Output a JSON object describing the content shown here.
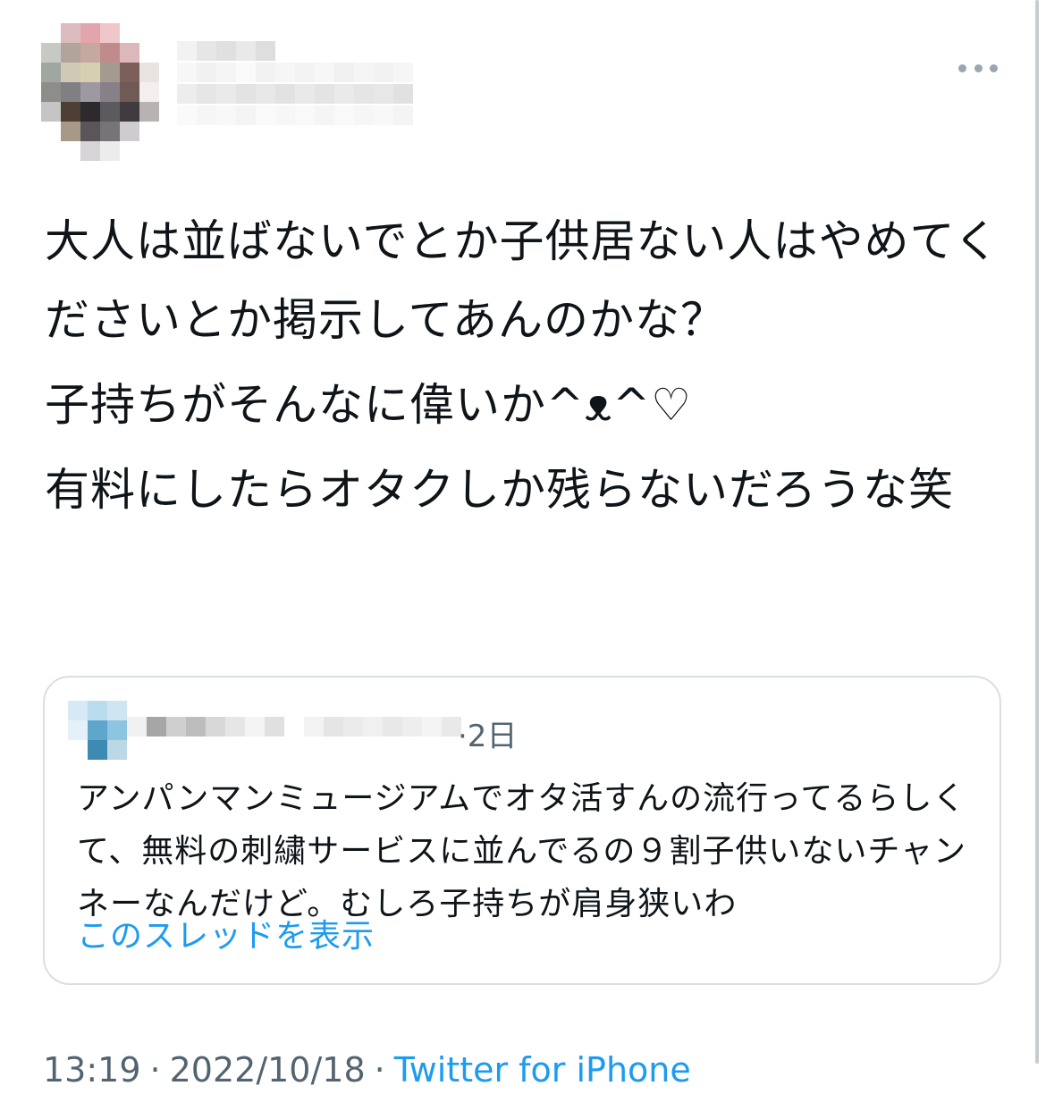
{
  "tweet": {
    "lines": [
      "大人は並ばないでとか子供居ない人はやめてくださいとか掲示してあんのかな？",
      "子持ちがそんなに偉いか^ᴥ^♡",
      "有料にしたらオタクしか残らないだろうな笑"
    ],
    "more_icon": "more-horizontal-icon"
  },
  "quoted_tweet": {
    "time": "·2日",
    "text": "アンパンマンミュージアムでオタ活すんの流行ってるらしくて、無料の刺繍サービスに並んでるの９割子供いないチャンネーなんだけど。むしろ子持ちが肩身狭いわ",
    "thread_link": "このスレッドを表示"
  },
  "meta": {
    "time": "13:19",
    "date": "2022/10/18",
    "source": "Twitter for iPhone",
    "sep": "·"
  },
  "colors": {
    "text": "#0f1419",
    "secondary": "#536471",
    "link": "#1d9bf0",
    "border": "#d9dfe4"
  }
}
